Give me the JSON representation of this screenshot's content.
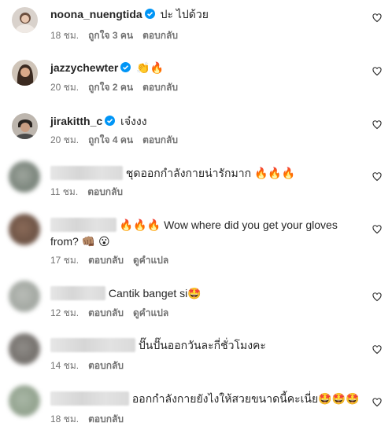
{
  "comments": [
    {
      "username": "noona_nuengtida",
      "verified": true,
      "text": "ปะ ไปด้วย",
      "time": "18 ชม.",
      "likes": "ถูกใจ 3 คน",
      "reply": "ตอบกลับ"
    },
    {
      "username": "jazzychewter",
      "verified": true,
      "text": "👏🔥",
      "time": "20 ชม.",
      "likes": "ถูกใจ 2 คน",
      "reply": "ตอบกลับ"
    },
    {
      "username": "jirakitth_c",
      "verified": true,
      "text": "เจ๋งงง",
      "time": "20 ชม.",
      "likes": "ถูกใจ 4 คน",
      "reply": "ตอบกลับ"
    },
    {
      "text": "ชุดออกกำลังกายน่ารักมาก 🔥🔥🔥",
      "time": "11 ชม.",
      "reply": "ตอบกลับ"
    },
    {
      "text_line1": "🔥🔥🔥 Wow where did you get your gloves",
      "text_line2": "from? 👊🏽 😮",
      "time": "17 ชม.",
      "reply": "ตอบกลับ",
      "translate": "ดูคำแปล"
    },
    {
      "text": "Cantik banget si🤩",
      "time": "12 ชม.",
      "reply": "ตอบกลับ",
      "translate": "ดูคำแปล"
    },
    {
      "text": "ปั๊นปั๊นออกวันละกี่ชั่วโมงคะ",
      "time": "14 ชม.",
      "reply": "ตอบกลับ"
    },
    {
      "text": "ออกกำลังกายยังไงให้สวยขนาดนี้คะเนี่ย🤩🤩🤩",
      "time": "18 ชม.",
      "reply": "ตอบกลับ"
    }
  ],
  "icons": {
    "verified": "verified-badge-icon",
    "like": "heart-outline-icon"
  },
  "colors": {
    "verified": "#0095f6",
    "meta": "#737373",
    "text": "#262626"
  }
}
